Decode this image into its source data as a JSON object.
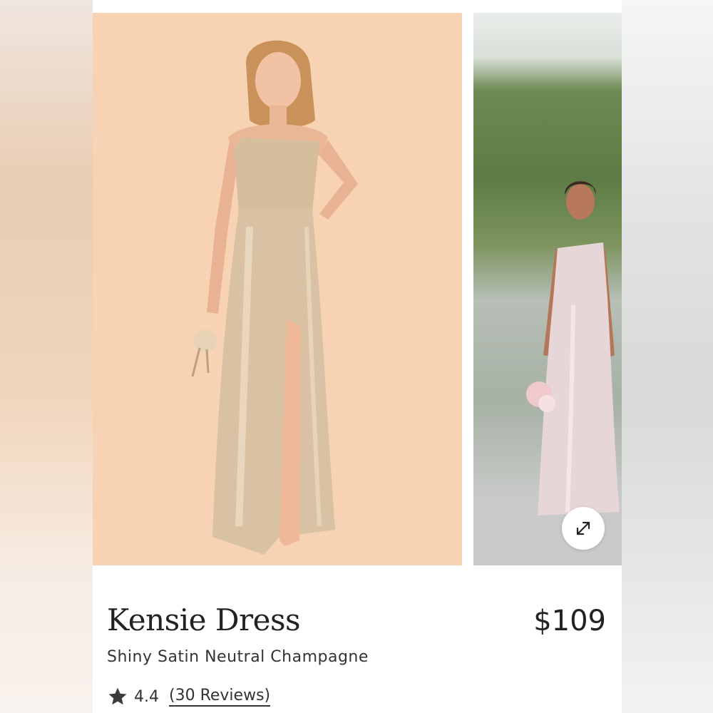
{
  "product": {
    "name": "Kensie Dress",
    "subtitle": "Shiny Satin Neutral Champagne",
    "price": "$109",
    "rating": "4.4",
    "reviews_label": "(30 Reviews)"
  },
  "icons": {
    "rating": "star-icon",
    "expand": "expand-icon"
  },
  "colors": {
    "main_image_background": "#f7d3b3",
    "text": "#222222",
    "dress": "#d9c2a4"
  }
}
